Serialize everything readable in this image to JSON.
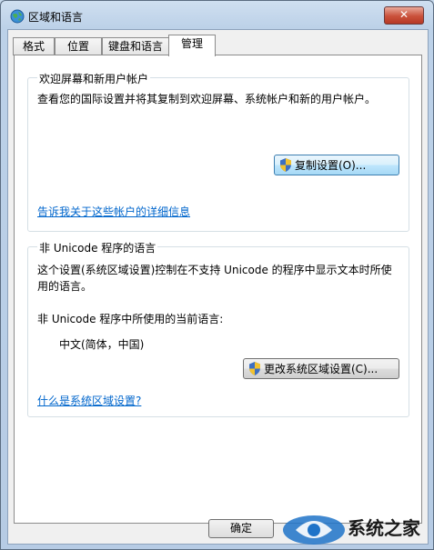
{
  "window": {
    "title": "区域和语言",
    "close_label": "✕"
  },
  "tabs": [
    {
      "label": "格式"
    },
    {
      "label": "位置"
    },
    {
      "label": "键盘和语言"
    },
    {
      "label": "管理"
    }
  ],
  "welcome_group": {
    "title": "欢迎屏幕和新用户帐户",
    "description": "查看您的国际设置并将其复制到欢迎屏幕、系统帐户和新的用户帐户。",
    "copy_button": "复制设置(O)...",
    "link": "告诉我关于这些帐户的详细信息"
  },
  "nonunicode_group": {
    "title": "非 Unicode 程序的语言",
    "description_line1": "这个设置(系统区域设置)控制在不支持 Unicode 的程序中显示文本时所使",
    "description_line2": "用的语言。",
    "current_label": "非 Unicode 程序中所使用的当前语言:",
    "current_value": "中文(简体，中国)",
    "change_button": "更改系统区域设置(C)...",
    "link": "什么是系统区域设置?"
  },
  "footer": {
    "ok_button": "确定"
  },
  "watermark": {
    "text": "系统之家"
  },
  "colors": {
    "link": "#0066cc",
    "close_button": "#c9503a",
    "title_bar": "#bcd1e8"
  }
}
